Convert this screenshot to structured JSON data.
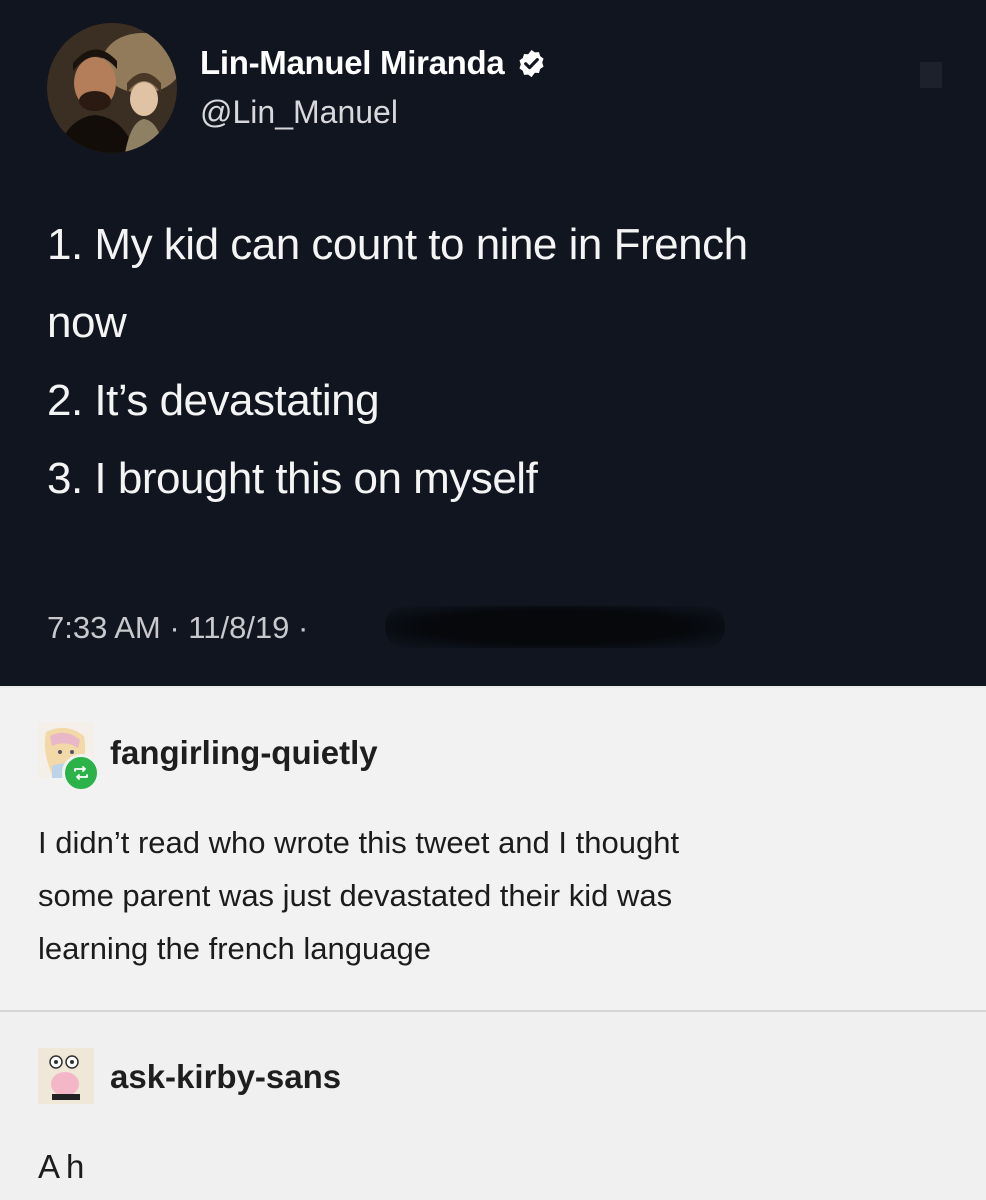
{
  "tweet": {
    "author_name": "Lin-Manuel Miranda",
    "handle": "@Lin_Manuel",
    "lines": [
      "1. My kid can count to nine in French",
      "now",
      "2. It’s devastating",
      "3. I brought this on myself"
    ],
    "timestamp": "7:33 AM · 11/8/19 ·",
    "verified_icon": "verified-badge-icon"
  },
  "posts": [
    {
      "blog_name": "fangirling-quietly",
      "reblog_icon": "reblog-icon",
      "text_lines": [
        "I didn’t read who wrote this tweet and I thought",
        "some parent was just devastated their kid was",
        "learning the french language"
      ]
    },
    {
      "blog_name": "ask-kirby-sans",
      "text": "Ah"
    }
  ],
  "colors": {
    "tweet_background": "#101520",
    "post_background": "#f2f2f2",
    "reblog_green": "#2bb34a"
  }
}
